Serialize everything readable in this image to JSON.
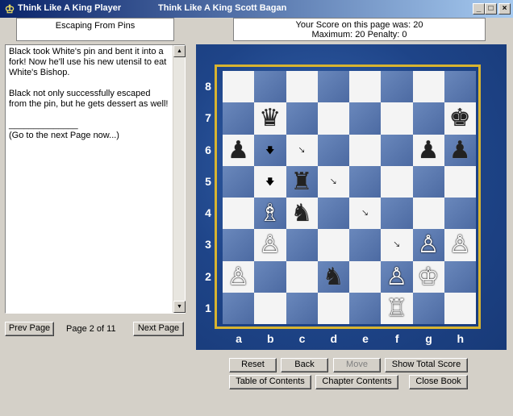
{
  "window": {
    "app_title": "Think Like A King Player",
    "doc_title": "Think Like A King   Scott  Bagan",
    "minimize": "_",
    "maximize": "□",
    "close": "×"
  },
  "chapter_title": "Escaping From Pins",
  "score": {
    "line1": "Your Score on this page was: 20",
    "line2": "Maximum: 20  Penalty: 0"
  },
  "lesson_text": "Black took White's pin and bent it into a fork! Now he'll use his new utensil to eat White's Bishop.\n\nBlack not only successfully escaped from the pin, but he gets dessert as well!\n\n______________\n(Go to the next Page now...)",
  "nav": {
    "prev": "Prev Page",
    "page_label": "Page 2 of 11",
    "next": "Next Page"
  },
  "buttons": {
    "reset": "Reset",
    "back": "Back",
    "move": "Move",
    "show_total": "Show Total Score",
    "toc": "Table of Contents",
    "chapter_contents": "Chapter Contents",
    "close_book": "Close Book"
  },
  "board": {
    "ranks": [
      "8",
      "7",
      "6",
      "5",
      "4",
      "3",
      "2",
      "1"
    ],
    "files": [
      "a",
      "b",
      "c",
      "d",
      "e",
      "f",
      "g",
      "h"
    ],
    "pieces": [
      {
        "sq": "b7",
        "glyph": "♛",
        "color": "black",
        "name": "black-queen-icon"
      },
      {
        "sq": "h7",
        "glyph": "♚",
        "color": "black",
        "name": "black-king-icon"
      },
      {
        "sq": "a6",
        "glyph": "♟",
        "color": "black",
        "name": "black-pawn-icon"
      },
      {
        "sq": "g6",
        "glyph": "♟",
        "color": "black",
        "name": "black-pawn-icon"
      },
      {
        "sq": "h6",
        "glyph": "♟",
        "color": "black",
        "name": "black-pawn-icon"
      },
      {
        "sq": "c5",
        "glyph": "♜",
        "color": "black",
        "name": "black-rook-icon"
      },
      {
        "sq": "b4",
        "glyph": "♗",
        "color": "white",
        "name": "white-bishop-icon"
      },
      {
        "sq": "c4",
        "glyph": "♞",
        "color": "black",
        "name": "black-knight-icon"
      },
      {
        "sq": "b3",
        "glyph": "♙",
        "color": "white",
        "name": "white-pawn-icon"
      },
      {
        "sq": "g3",
        "glyph": "♙",
        "color": "white",
        "name": "white-pawn-icon"
      },
      {
        "sq": "h3",
        "glyph": "♙",
        "color": "white",
        "name": "white-pawn-icon"
      },
      {
        "sq": "a2",
        "glyph": "♙",
        "color": "white",
        "name": "white-pawn-icon"
      },
      {
        "sq": "d2",
        "glyph": "♞",
        "color": "black",
        "name": "black-knight-icon"
      },
      {
        "sq": "f2",
        "glyph": "♙",
        "color": "white",
        "name": "white-pawn-icon"
      },
      {
        "sq": "g2",
        "glyph": "♔",
        "color": "white",
        "name": "white-king-icon"
      },
      {
        "sq": "f1",
        "glyph": "♖",
        "color": "white",
        "name": "white-rook-icon"
      }
    ],
    "arrows": [
      {
        "sq": "b6",
        "glyph": "🡇",
        "name": "arrow-down-icon"
      },
      {
        "sq": "c6",
        "glyph": "🡖",
        "name": "arrow-down-right-icon"
      },
      {
        "sq": "b5",
        "glyph": "🡇",
        "name": "arrow-down-icon"
      },
      {
        "sq": "d5",
        "glyph": "🡖",
        "name": "arrow-down-right-icon"
      },
      {
        "sq": "e4",
        "glyph": "🡖",
        "name": "arrow-down-right-icon"
      },
      {
        "sq": "f3",
        "glyph": "🡖",
        "name": "arrow-down-right-icon"
      }
    ]
  }
}
